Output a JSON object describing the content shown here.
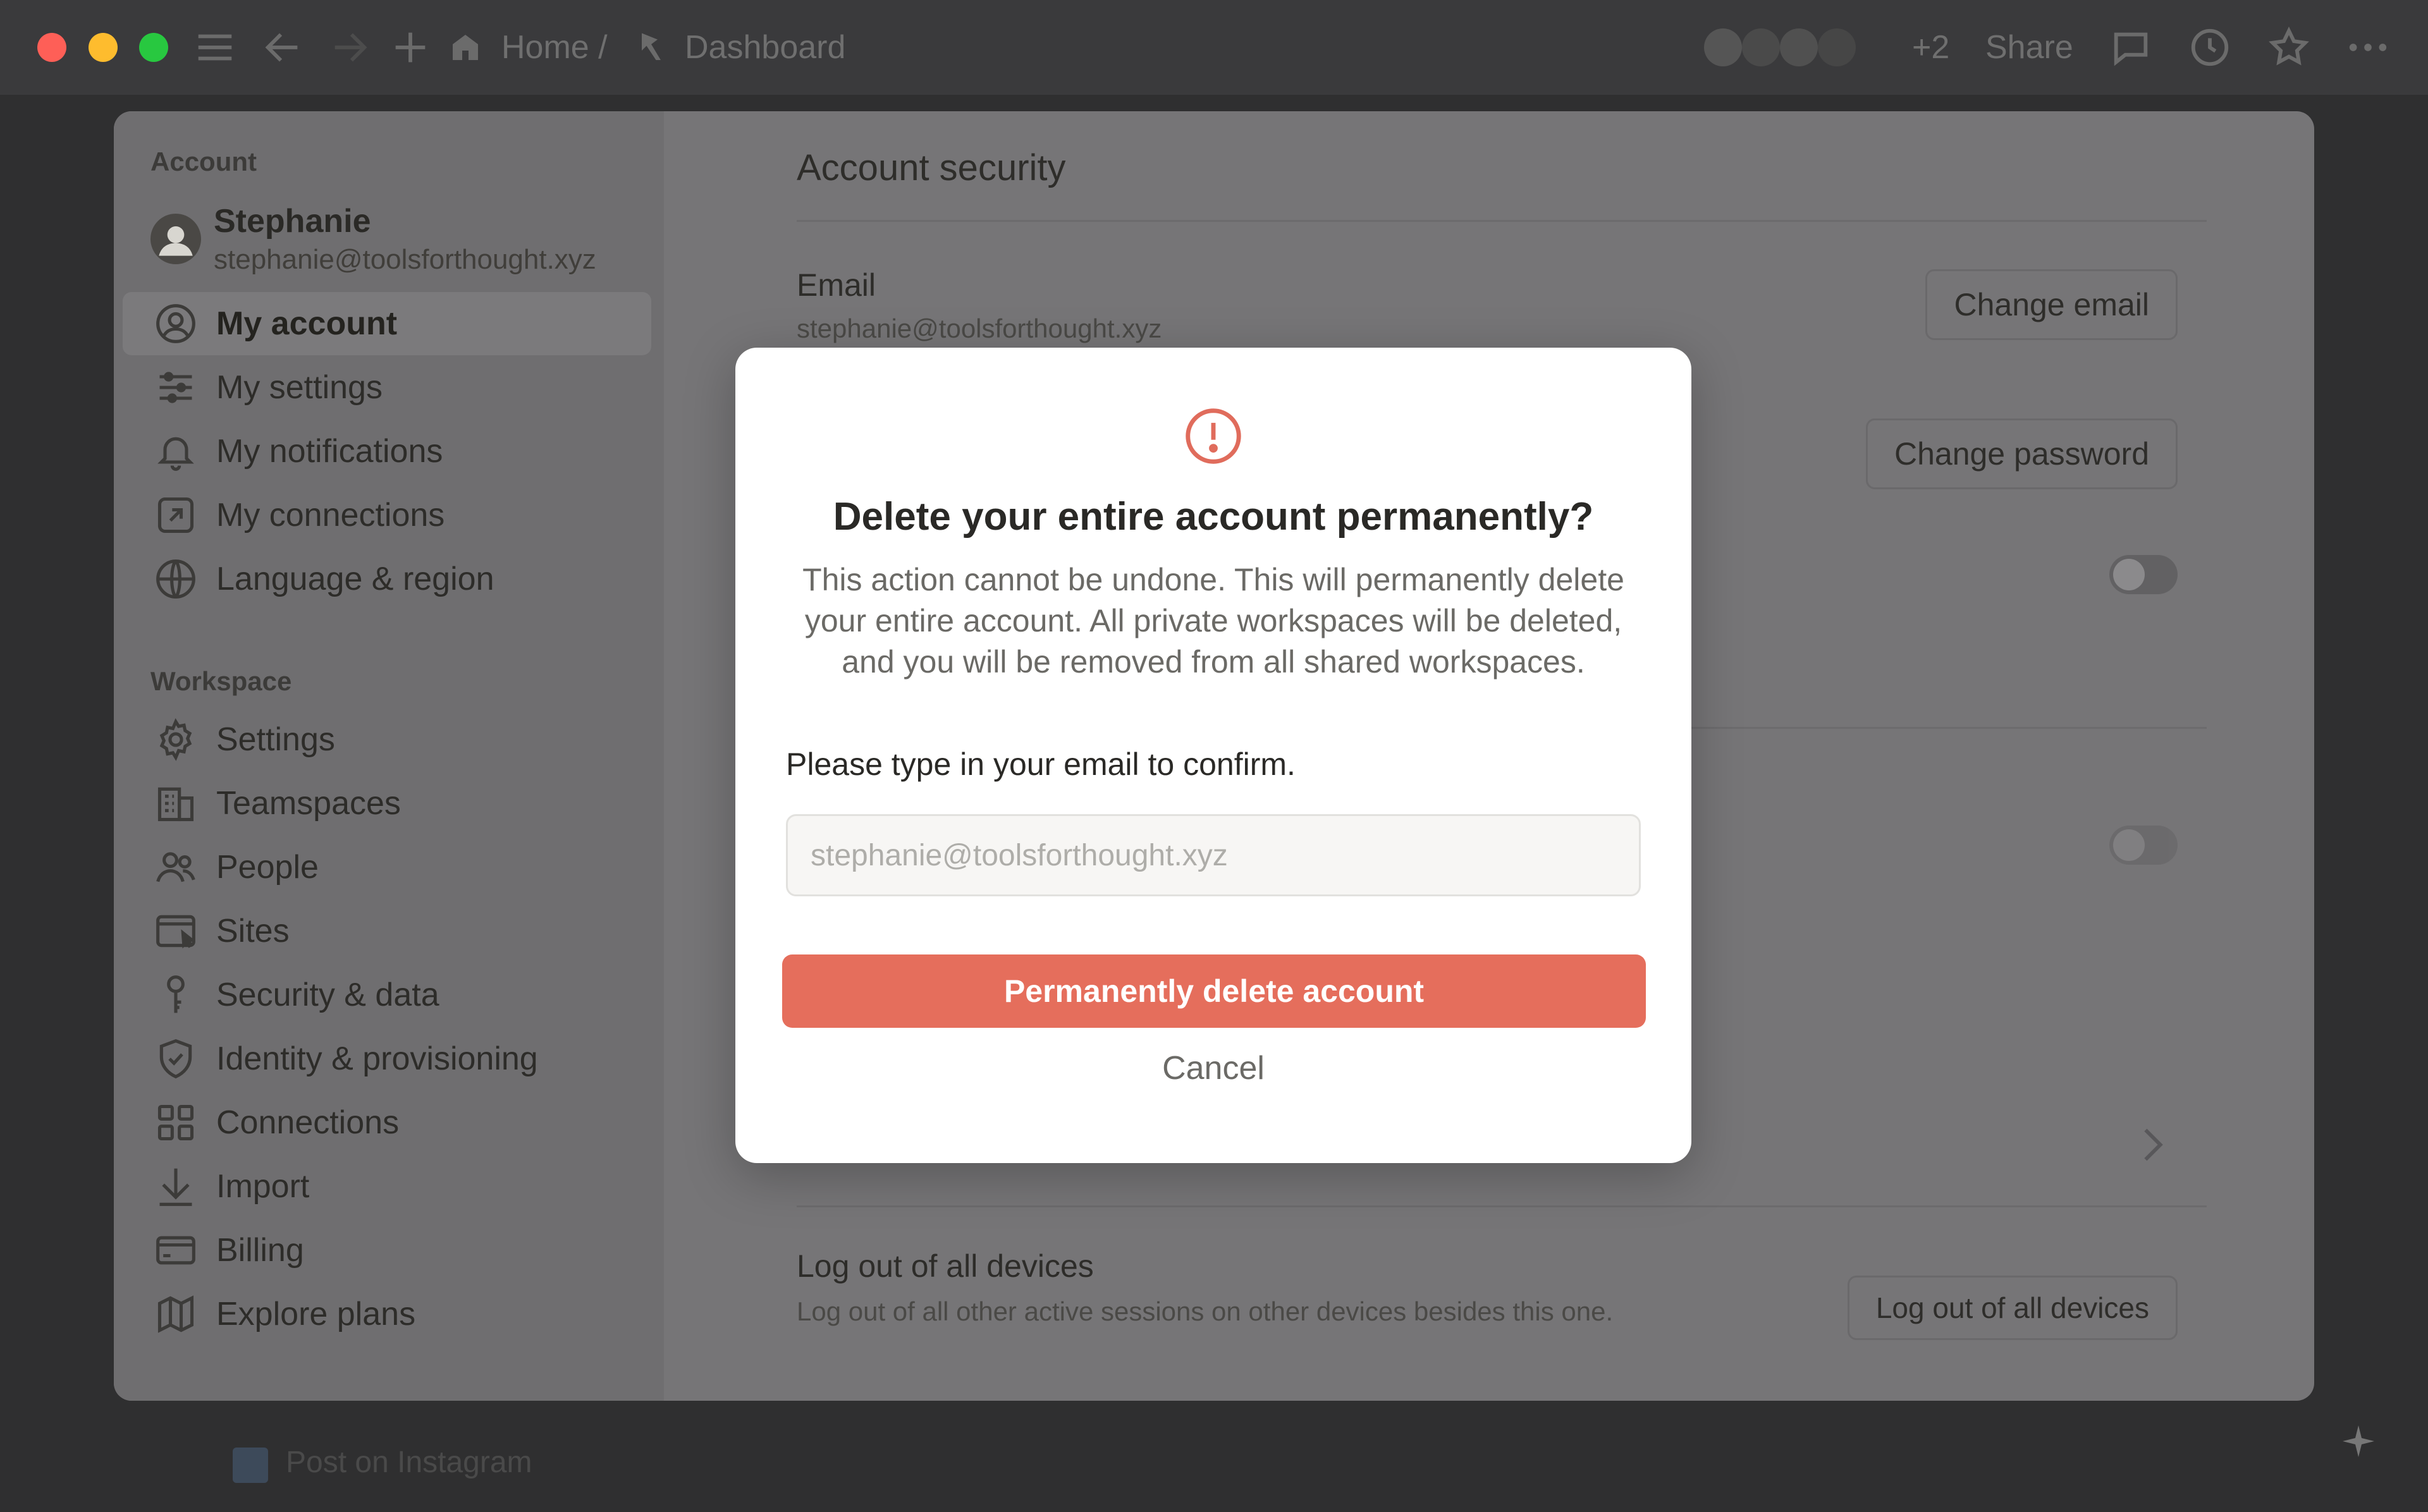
{
  "titlebar": {
    "breadcrumb_home": "Home /",
    "breadcrumb_page": "Dashboard",
    "extra_count": "+2",
    "share_label": "Share"
  },
  "background": {
    "task_label": "Post on Instagram"
  },
  "sidebar": {
    "account_heading": "Account",
    "profile": {
      "name": "Stephanie",
      "email": "stephanie@toolsforthought.xyz"
    },
    "account_items": [
      {
        "label": "My account",
        "icon": "user-circle-icon",
        "active": true
      },
      {
        "label": "My settings",
        "icon": "sliders-icon"
      },
      {
        "label": "My notifications",
        "icon": "bell-icon"
      },
      {
        "label": "My connections",
        "icon": "external-link-icon"
      },
      {
        "label": "Language & region",
        "icon": "globe-icon"
      }
    ],
    "workspace_heading": "Workspace",
    "workspace_items": [
      {
        "label": "Settings",
        "icon": "gear-icon"
      },
      {
        "label": "Teamspaces",
        "icon": "building-icon"
      },
      {
        "label": "People",
        "icon": "people-icon"
      },
      {
        "label": "Sites",
        "icon": "browser-window-icon"
      },
      {
        "label": "Security & data",
        "icon": "key-icon"
      },
      {
        "label": "Identity & provisioning",
        "icon": "shield-check-icon"
      },
      {
        "label": "Connections",
        "icon": "grid-icon"
      },
      {
        "label": "Import",
        "icon": "download-arrow-icon"
      },
      {
        "label": "Billing",
        "icon": "credit-card-icon"
      },
      {
        "label": "Explore plans",
        "icon": "map-icon"
      }
    ]
  },
  "content": {
    "title": "Account security",
    "email_label": "Email",
    "email_value": "stephanie@toolsforthought.xyz",
    "change_email": "Change email",
    "change_password": "Change password",
    "logout_label": "Log out of all devices",
    "logout_desc": "Log out of all other active sessions on other devices besides this one.",
    "logout_button": "Log out of all devices"
  },
  "dialog": {
    "title": "Delete your entire account permanently?",
    "body": "This action cannot be undone. This will permanently delete your entire account. All private workspaces will be deleted, and you will be removed from all shared workspaces.",
    "prompt": "Please type in your email to confirm.",
    "input_placeholder": "stephanie@toolsforthought.xyz",
    "delete_button": "Permanently delete account",
    "cancel_button": "Cancel",
    "accent_color": "#e56e5c"
  }
}
